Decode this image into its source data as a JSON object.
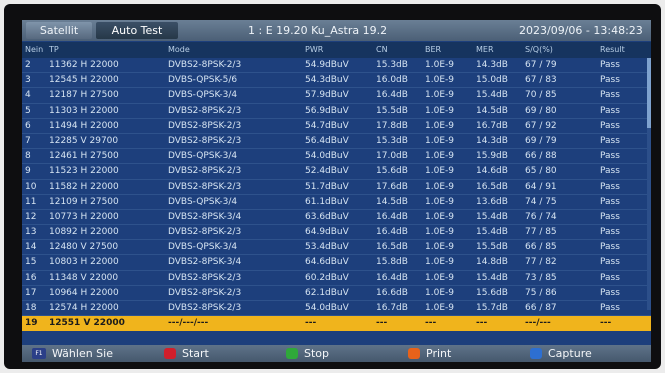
{
  "topbar": {
    "tabs": [
      "Satellit",
      "Auto Test"
    ],
    "transponder": "1 : E 19.20  Ku_Astra 19.2",
    "datetime": "2023/09/06 - 13:48:23"
  },
  "table": {
    "columns": [
      "Nein",
      "TP",
      "Mode",
      "PWR",
      "CN",
      "BER",
      "MER",
      "S/Q(%)",
      "Result"
    ],
    "rows": [
      [
        "2",
        "11362  H  22000",
        "DVBS2-8PSK-2/3",
        "54.9dBuV",
        "15.3dB",
        "1.0E-9",
        "14.3dB",
        "67 / 79",
        "Pass"
      ],
      [
        "3",
        "12545  H  22000",
        "DVBS-QPSK-5/6",
        "54.3dBuV",
        "16.0dB",
        "1.0E-9",
        "15.0dB",
        "67 / 83",
        "Pass"
      ],
      [
        "4",
        "12187  H  27500",
        "DVBS-QPSK-3/4",
        "57.9dBuV",
        "16.4dB",
        "1.0E-9",
        "15.4dB",
        "70 / 85",
        "Pass"
      ],
      [
        "5",
        "11303  H  22000",
        "DVBS2-8PSK-2/3",
        "56.9dBuV",
        "15.5dB",
        "1.0E-9",
        "14.5dB",
        "69 / 80",
        "Pass"
      ],
      [
        "6",
        "11494  H  22000",
        "DVBS2-8PSK-2/3",
        "54.7dBuV",
        "17.8dB",
        "1.0E-9",
        "16.7dB",
        "67 / 92",
        "Pass"
      ],
      [
        "7",
        "12285  V  29700",
        "DVBS2-8PSK-2/3",
        "56.4dBuV",
        "15.3dB",
        "1.0E-9",
        "14.3dB",
        "69 / 79",
        "Pass"
      ],
      [
        "8",
        "12461  H  27500",
        "DVBS-QPSK-3/4",
        "54.0dBuV",
        "17.0dB",
        "1.0E-9",
        "15.9dB",
        "66 / 88",
        "Pass"
      ],
      [
        "9",
        "11523  H  22000",
        "DVBS2-8PSK-2/3",
        "52.4dBuV",
        "15.6dB",
        "1.0E-9",
        "14.6dB",
        "65 / 80",
        "Pass"
      ],
      [
        "10",
        "11582  H  22000",
        "DVBS2-8PSK-2/3",
        "51.7dBuV",
        "17.6dB",
        "1.0E-9",
        "16.5dB",
        "64 / 91",
        "Pass"
      ],
      [
        "11",
        "12109  H  27500",
        "DVBS-QPSK-3/4",
        "61.1dBuV",
        "14.5dB",
        "1.0E-9",
        "13.6dB",
        "74 / 75",
        "Pass"
      ],
      [
        "12",
        "10773  H  22000",
        "DVBS2-8PSK-3/4",
        "63.6dBuV",
        "16.4dB",
        "1.0E-9",
        "15.4dB",
        "76 / 74",
        "Pass"
      ],
      [
        "13",
        "10892  H  22000",
        "DVBS2-8PSK-2/3",
        "64.9dBuV",
        "16.4dB",
        "1.0E-9",
        "15.4dB",
        "77 / 85",
        "Pass"
      ],
      [
        "14",
        "12480  V  27500",
        "DVBS-QPSK-3/4",
        "53.4dBuV",
        "16.5dB",
        "1.0E-9",
        "15.5dB",
        "66 / 85",
        "Pass"
      ],
      [
        "15",
        "10803  H  22000",
        "DVBS2-8PSK-3/4",
        "64.6dBuV",
        "15.8dB",
        "1.0E-9",
        "14.8dB",
        "77 / 82",
        "Pass"
      ],
      [
        "16",
        "11348  V  22000",
        "DVBS2-8PSK-2/3",
        "60.2dBuV",
        "16.4dB",
        "1.0E-9",
        "15.4dB",
        "73 / 85",
        "Pass"
      ],
      [
        "17",
        "10964  H  22000",
        "DVBS2-8PSK-2/3",
        "62.1dBuV",
        "16.6dB",
        "1.0E-9",
        "15.6dB",
        "75 / 86",
        "Pass"
      ],
      [
        "18",
        "12574  H  22000",
        "DVBS2-8PSK-2/3",
        "54.0dBuV",
        "16.7dB",
        "1.0E-9",
        "15.7dB",
        "66 / 87",
        "Pass"
      ],
      [
        "19",
        "12551  V  22000",
        "---/---/---",
        "---",
        "---",
        "---",
        "---",
        "---/---",
        "---"
      ]
    ]
  },
  "bottombar": {
    "keys": [
      {
        "label": "Wählen Sie",
        "icon": "f1-key-icon",
        "badge": "F1"
      },
      {
        "label": "Start",
        "icon": "red-button-icon",
        "color": "#d01f2b"
      },
      {
        "label": "Stop",
        "icon": "green-button-icon",
        "color": "#2fa83a"
      },
      {
        "label": "Print",
        "icon": "orange-button-icon",
        "color": "#e8621a"
      },
      {
        "label": "Capture",
        "icon": "blue-button-icon",
        "color": "#2d6fd1"
      }
    ]
  },
  "colors": {
    "screen_bg": "#1d3f7c",
    "selected_row": "#f0b41c",
    "topbar": "#5a6e84"
  }
}
